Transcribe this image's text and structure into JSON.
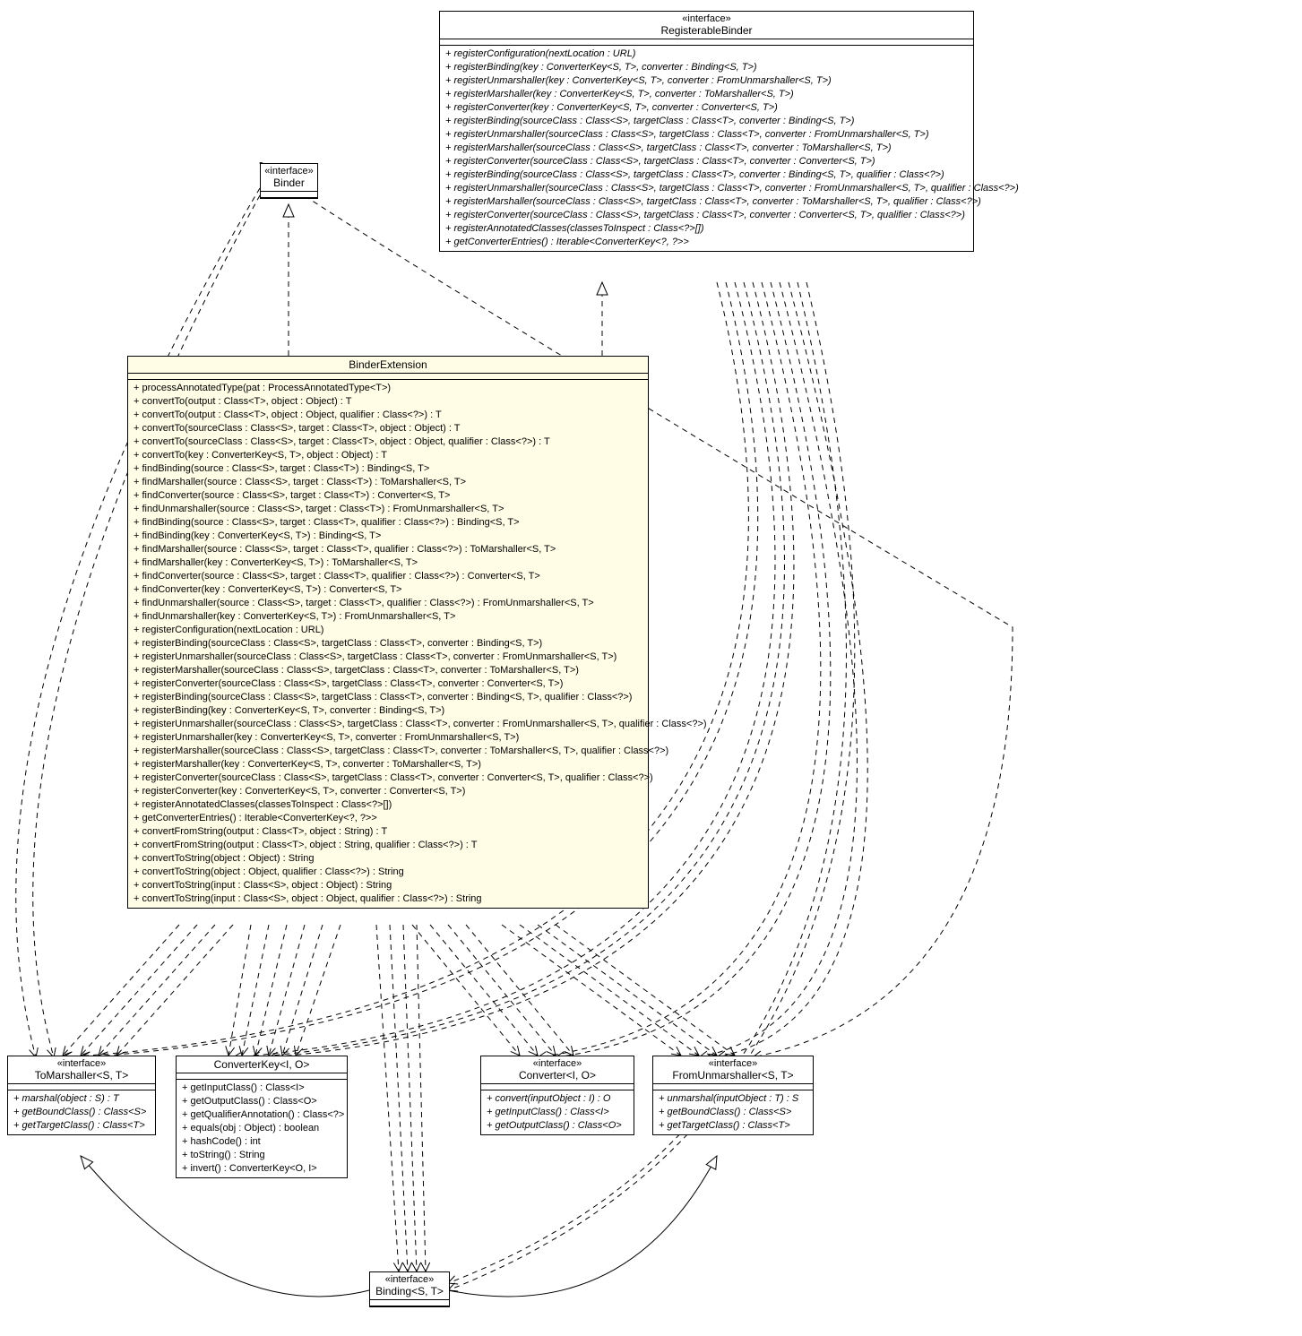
{
  "binder": {
    "stereo": "«interface»",
    "name": "Binder"
  },
  "registerableBinder": {
    "stereo": "«interface»",
    "name": "RegisterableBinder",
    "ops": [
      "+ registerConfiguration(nextLocation : URL)",
      "+ registerBinding(key : ConverterKey<S, T>, converter : Binding<S, T>)",
      "+ registerUnmarshaller(key : ConverterKey<S, T>, converter : FromUnmarshaller<S, T>)",
      "+ registerMarshaller(key : ConverterKey<S, T>, converter : ToMarshaller<S, T>)",
      "+ registerConverter(key : ConverterKey<S, T>, converter : Converter<S, T>)",
      "+ registerBinding(sourceClass : Class<S>, targetClass : Class<T>, converter : Binding<S, T>)",
      "+ registerUnmarshaller(sourceClass : Class<S>, targetClass : Class<T>, converter : FromUnmarshaller<S, T>)",
      "+ registerMarshaller(sourceClass : Class<S>, targetClass : Class<T>, converter : ToMarshaller<S, T>)",
      "+ registerConverter(sourceClass : Class<S>, targetClass : Class<T>, converter : Converter<S, T>)",
      "+ registerBinding(sourceClass : Class<S>, targetClass : Class<T>, converter : Binding<S, T>, qualifier : Class<?>)",
      "+ registerUnmarshaller(sourceClass : Class<S>, targetClass : Class<T>, converter : FromUnmarshaller<S, T>, qualifier : Class<?>)",
      "+ registerMarshaller(sourceClass : Class<S>, targetClass : Class<T>, converter : ToMarshaller<S, T>, qualifier : Class<?>)",
      "+ registerConverter(sourceClass : Class<S>, targetClass : Class<T>, converter : Converter<S, T>, qualifier : Class<?>)",
      "+ registerAnnotatedClasses(classesToInspect : Class<?>[])",
      "+ getConverterEntries() : Iterable<ConverterKey<?, ?>>"
    ]
  },
  "binderExtension": {
    "name": "BinderExtension",
    "ops": [
      "+ processAnnotatedType(pat : ProcessAnnotatedType<T>)",
      "+ convertTo(output : Class<T>, object : Object) : T",
      "+ convertTo(output : Class<T>, object : Object, qualifier : Class<?>) : T",
      "+ convertTo(sourceClass : Class<S>, target : Class<T>, object : Object) : T",
      "+ convertTo(sourceClass : Class<S>, target : Class<T>, object : Object, qualifier : Class<?>) : T",
      "+ convertTo(key : ConverterKey<S, T>, object : Object) : T",
      "+ findBinding(source : Class<S>, target : Class<T>) : Binding<S, T>",
      "+ findMarshaller(source : Class<S>, target : Class<T>) : ToMarshaller<S, T>",
      "+ findConverter(source : Class<S>, target : Class<T>) : Converter<S, T>",
      "+ findUnmarshaller(source : Class<S>, target : Class<T>) : FromUnmarshaller<S, T>",
      "+ findBinding(source : Class<S>, target : Class<T>, qualifier : Class<?>) : Binding<S, T>",
      "+ findBinding(key : ConverterKey<S, T>) : Binding<S, T>",
      "+ findMarshaller(source : Class<S>, target : Class<T>, qualifier : Class<?>) : ToMarshaller<S, T>",
      "+ findMarshaller(key : ConverterKey<S, T>) : ToMarshaller<S, T>",
      "+ findConverter(source : Class<S>, target : Class<T>, qualifier : Class<?>) : Converter<S, T>",
      "+ findConverter(key : ConverterKey<S, T>) : Converter<S, T>",
      "+ findUnmarshaller(source : Class<S>, target : Class<T>, qualifier : Class<?>) : FromUnmarshaller<S, T>",
      "+ findUnmarshaller(key : ConverterKey<S, T>) : FromUnmarshaller<S, T>",
      "+ registerConfiguration(nextLocation : URL)",
      "+ registerBinding(sourceClass : Class<S>, targetClass : Class<T>, converter : Binding<S, T>)",
      "+ registerUnmarshaller(sourceClass : Class<S>, targetClass : Class<T>, converter : FromUnmarshaller<S, T>)",
      "+ registerMarshaller(sourceClass : Class<S>, targetClass : Class<T>, converter : ToMarshaller<S, T>)",
      "+ registerConverter(sourceClass : Class<S>, targetClass : Class<T>, converter : Converter<S, T>)",
      "+ registerBinding(sourceClass : Class<S>, targetClass : Class<T>, converter : Binding<S, T>, qualifier : Class<?>)",
      "+ registerBinding(key : ConverterKey<S, T>, converter : Binding<S, T>)",
      "+ registerUnmarshaller(sourceClass : Class<S>, targetClass : Class<T>, converter : FromUnmarshaller<S, T>, qualifier : Class<?>)",
      "+ registerUnmarshaller(key : ConverterKey<S, T>, converter : FromUnmarshaller<S, T>)",
      "+ registerMarshaller(sourceClass : Class<S>, targetClass : Class<T>, converter : ToMarshaller<S, T>, qualifier : Class<?>)",
      "+ registerMarshaller(key : ConverterKey<S, T>, converter : ToMarshaller<S, T>)",
      "+ registerConverter(sourceClass : Class<S>, targetClass : Class<T>, converter : Converter<S, T>, qualifier : Class<?>)",
      "+ registerConverter(key : ConverterKey<S, T>, converter : Converter<S, T>)",
      "+ registerAnnotatedClasses(classesToInspect : Class<?>[])",
      "+ getConverterEntries() : Iterable<ConverterKey<?, ?>>",
      "+ convertFromString(output : Class<T>, object : String) : T",
      "+ convertFromString(output : Class<T>, object : String, qualifier : Class<?>) : T",
      "+ convertToString(object : Object) : String",
      "+ convertToString(object : Object, qualifier : Class<?>) : String",
      "+ convertToString(input : Class<S>, object : Object) : String",
      "+ convertToString(input : Class<S>, object : Object, qualifier : Class<?>) : String"
    ]
  },
  "toMarshaller": {
    "stereo": "«interface»",
    "name": "ToMarshaller<S, T>",
    "ops": [
      "+ marshal(object : S) : T",
      "+ getBoundClass() : Class<S>",
      "+ getTargetClass() : Class<T>"
    ]
  },
  "converterKey": {
    "name": "ConverterKey<I, O>",
    "ops": [
      "+ getInputClass() : Class<I>",
      "+ getOutputClass() : Class<O>",
      "+ getQualifierAnnotation() : Class<?>",
      "+ equals(obj : Object) : boolean",
      "+ hashCode() : int",
      "+ toString() : String",
      "+ invert() : ConverterKey<O, I>"
    ]
  },
  "converter": {
    "stereo": "«interface»",
    "name": "Converter<I, O>",
    "ops": [
      "+ convert(inputObject : I) : O",
      "+ getInputClass() : Class<I>",
      "+ getOutputClass() : Class<O>"
    ]
  },
  "fromUnmarshaller": {
    "stereo": "«interface»",
    "name": "FromUnmarshaller<S, T>",
    "ops": [
      "+ unmarshal(inputObject : T) : S",
      "+ getBoundClass() : Class<S>",
      "+ getTargetClass() : Class<T>"
    ]
  },
  "binding": {
    "stereo": "«interface»",
    "name": "Binding<S, T>"
  }
}
